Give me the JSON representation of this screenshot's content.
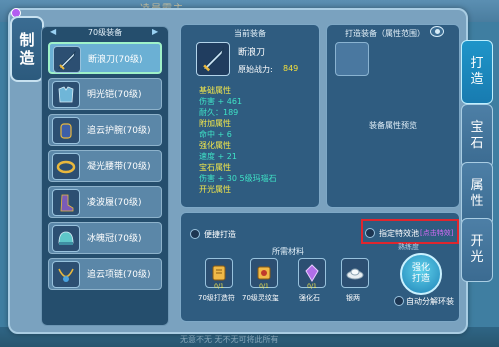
{
  "background": {
    "top_text": "凌晨霸主",
    "bottom_text": "无意不无 无不无可将此所有"
  },
  "left_tab": {
    "label_top": "制",
    "label_bottom": "造"
  },
  "list": {
    "header": "70级装备",
    "items": [
      {
        "label": "断浪刀(70级)",
        "icon": "sword-icon",
        "selected": true
      },
      {
        "label": "明光铠(70级)",
        "icon": "armor-icon",
        "selected": false
      },
      {
        "label": "追云护腕(70级)",
        "icon": "bracer-icon",
        "selected": false
      },
      {
        "label": "凝光腰带(70级)",
        "icon": "belt-icon",
        "selected": false
      },
      {
        "label": "凌波履(70级)",
        "icon": "boots-icon",
        "selected": false
      },
      {
        "label": "冰魄冠(70级)",
        "icon": "helmet-icon",
        "selected": false
      },
      {
        "label": "追云项链(70级)",
        "icon": "necklace-icon",
        "selected": false
      }
    ]
  },
  "current_equipment": {
    "header": "当前装备",
    "name": "断浪刀",
    "power_label": "原始战力:",
    "power_value": "849",
    "attributes": [
      {
        "text": "基础属性",
        "type": "h"
      },
      {
        "text": "伤害 + 461",
        "type": "v"
      },
      {
        "text": "耐久：189",
        "type": "v"
      },
      {
        "text": "附加属性",
        "type": "h"
      },
      {
        "text": "命中 + 6",
        "type": "v"
      },
      {
        "text": "强化属性",
        "type": "h"
      },
      {
        "text": "速度 + 21",
        "type": "v"
      },
      {
        "text": "宝石属性",
        "type": "h"
      },
      {
        "text": "伤害 + 30   5级玛瑙石",
        "type": "v"
      },
      {
        "text": "开光属性",
        "type": "h"
      }
    ]
  },
  "crafted_equipment": {
    "header": "打造装备（属性范围）",
    "preview_label": "装备属性预览"
  },
  "crafting": {
    "convenient_label": "便捷打造",
    "special_effect_label": "指定特效池",
    "special_effect_value": "[点击特效]",
    "materials_title": "所需材料",
    "materials": [
      {
        "label": "70级打造符",
        "count": "0/1",
        "icon": "scroll-icon"
      },
      {
        "label": "70级灵纹玺",
        "count": "0/1",
        "icon": "stone-icon"
      },
      {
        "label": "强化石",
        "count": "0/1",
        "icon": "crystal-icon"
      },
      {
        "label": "银两",
        "count": "",
        "icon": "silver-icon"
      }
    ],
    "craft_top_hint": "熟练度",
    "craft_button_line1": "强化",
    "craft_button_line2": "打造",
    "auto_decompose_label": "自动分解环装"
  },
  "side_tabs": [
    {
      "l1": "打",
      "l2": "造",
      "active": true
    },
    {
      "l1": "宝",
      "l2": "石",
      "active": false
    },
    {
      "l1": "属",
      "l2": "性",
      "active": false
    },
    {
      "l1": "开",
      "l2": "光",
      "active": false
    }
  ],
  "colors": {
    "attr_header": "#f5e84a",
    "attr_value": "#3fe3c6",
    "power": "#f4e03d",
    "highlight_border": "#e0262e",
    "special_text": "#d66af5"
  }
}
